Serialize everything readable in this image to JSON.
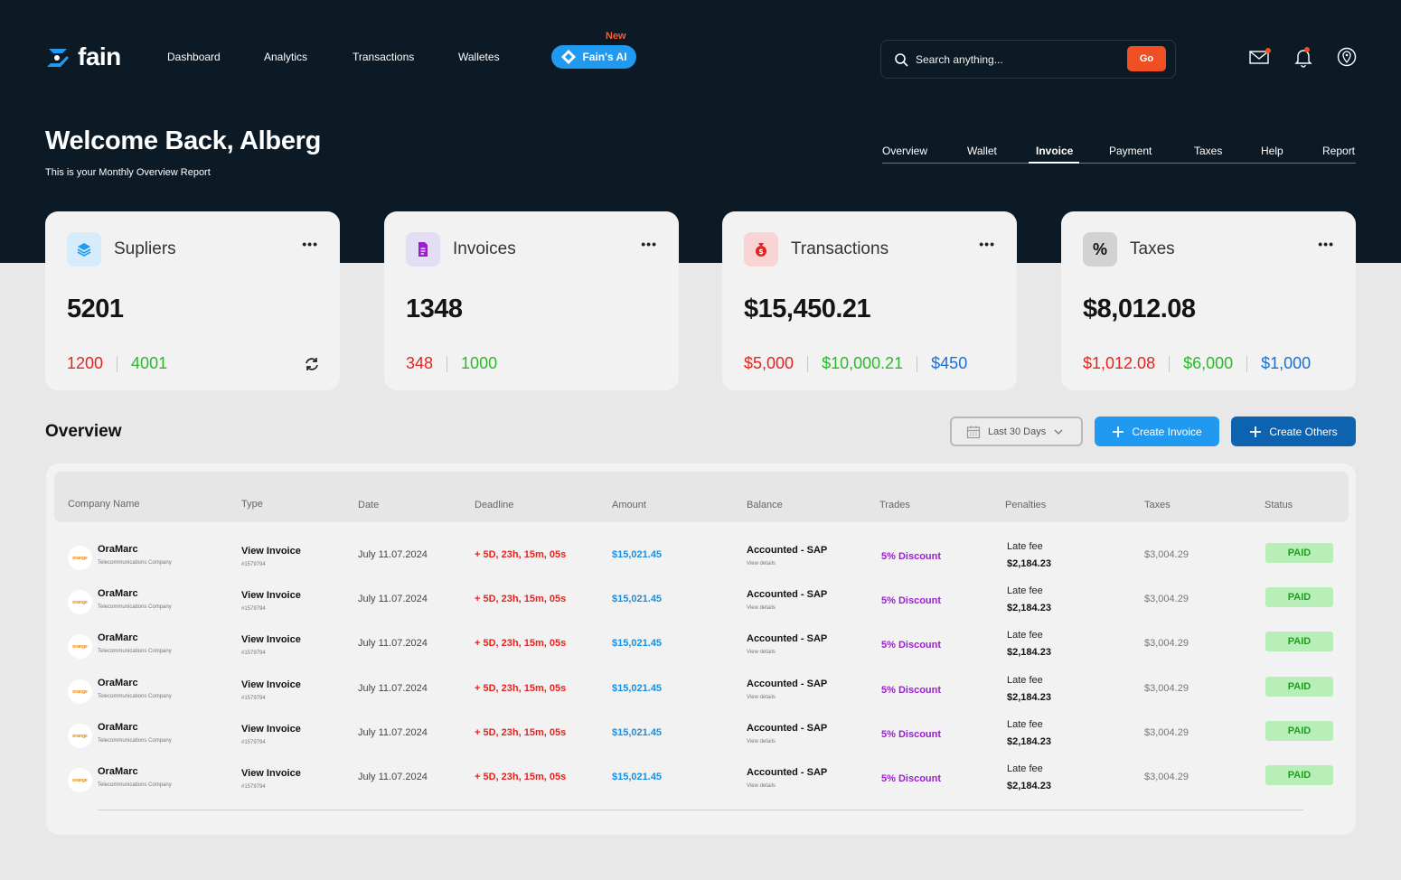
{
  "brand": {
    "name": "fain"
  },
  "nav": {
    "items": [
      "Dashboard",
      "Analytics",
      "Transactions",
      "Walletes"
    ],
    "ai_badge": "New",
    "ai_label": "Fain's AI"
  },
  "search": {
    "placeholder": "Search anything...",
    "go_label": "Go"
  },
  "top_icons": [
    "mail-icon",
    "bell-icon",
    "location-icon"
  ],
  "header": {
    "welcome": "Welcome Back, Alberg",
    "subtitle": "This is your Monthly Overview Report"
  },
  "tabs": [
    "Overview",
    "Wallet",
    "Invoice",
    "Payment",
    "Taxes",
    "Help",
    "Report"
  ],
  "active_tab": "Invoice",
  "cards": [
    {
      "title": "Supliers",
      "value": "5201",
      "subs": [
        "1200",
        "4001"
      ],
      "icon": "layers-icon"
    },
    {
      "title": "Invoices",
      "value": "1348",
      "subs": [
        "348",
        "1000"
      ],
      "icon": "document-icon"
    },
    {
      "title": "Transactions",
      "value": "$15,450.21",
      "subs": [
        "$5,000",
        "$10,000.21",
        "$450"
      ],
      "icon": "money-bag-icon"
    },
    {
      "title": "Taxes",
      "value": "$8,012.08",
      "subs": [
        "$1,012.08",
        "$6,000",
        "$1,000"
      ],
      "icon": "percent-icon",
      "icon_glyph": "%"
    }
  ],
  "overview": {
    "title": "Overview",
    "date_range": "Last 30 Days",
    "create_invoice": "Create Invoice",
    "create_others": "Create Others"
  },
  "table": {
    "columns": [
      "Company Name",
      "Type",
      "Date",
      "Deadline",
      "Amount",
      "Balance",
      "Trades",
      "Penalties",
      "Taxes",
      "Status"
    ],
    "rows": [
      {
        "logo": "orange",
        "company": "OraMarc",
        "company_sub": "Telecommunications Company",
        "type": "View Invoice",
        "type_sub": "#1579794",
        "date": "July 11.07.2024",
        "deadline": "+ 5D, 23h, 15m, 05s",
        "amount": "$15,021.45",
        "balance": "Accounted - SAP",
        "balance_sub": "View details",
        "trade": "5% Discount",
        "penalty_label": "Late fee",
        "penalty": "$2,184.23",
        "tax": "$3,004.29",
        "status": "PAID"
      },
      {
        "logo": "orange",
        "company": "OraMarc",
        "company_sub": "Telecommunications Company",
        "type": "View Invoice",
        "type_sub": "#1579794",
        "date": "July 11.07.2024",
        "deadline": "+ 5D, 23h, 15m, 05s",
        "amount": "$15,021.45",
        "balance": "Accounted - SAP",
        "balance_sub": "View details",
        "trade": "5% Discount",
        "penalty_label": "Late fee",
        "penalty": "$2,184.23",
        "tax": "$3,004.29",
        "status": "PAID"
      },
      {
        "logo": "orange",
        "company": "OraMarc",
        "company_sub": "Telecommunications Company",
        "type": "View Invoice",
        "type_sub": "#1579794",
        "date": "July 11.07.2024",
        "deadline": "+ 5D, 23h, 15m, 05s",
        "amount": "$15,021.45",
        "balance": "Accounted - SAP",
        "balance_sub": "View details",
        "trade": "5% Discount",
        "penalty_label": "Late fee",
        "penalty": "$2,184.23",
        "tax": "$3,004.29",
        "status": "PAID"
      },
      {
        "logo": "orange",
        "company": "OraMarc",
        "company_sub": "Telecommunications Company",
        "type": "View Invoice",
        "type_sub": "#1579794",
        "date": "July 11.07.2024",
        "deadline": "+ 5D, 23h, 15m, 05s",
        "amount": "$15,021.45",
        "balance": "Accounted - SAP",
        "balance_sub": "View details",
        "trade": "5% Discount",
        "penalty_label": "Late fee",
        "penalty": "$2,184.23",
        "tax": "$3,004.29",
        "status": "PAID"
      },
      {
        "logo": "orange",
        "company": "OraMarc",
        "company_sub": "Telecommunications Company",
        "type": "View Invoice",
        "type_sub": "#1579794",
        "date": "July 11.07.2024",
        "deadline": "+ 5D, 23h, 15m, 05s",
        "amount": "$15,021.45",
        "balance": "Accounted - SAP",
        "balance_sub": "View details",
        "trade": "5% Discount",
        "penalty_label": "Late fee",
        "penalty": "$2,184.23",
        "tax": "$3,004.29",
        "status": "PAID"
      },
      {
        "logo": "orange",
        "company": "OraMarc",
        "company_sub": "Telecommunications Company",
        "type": "View Invoice",
        "type_sub": "#1579794",
        "date": "July 11.07.2024",
        "deadline": "+ 5D, 23h, 15m, 05s",
        "amount": "$15,021.45",
        "balance": "Accounted - SAP",
        "balance_sub": "View details",
        "trade": "5% Discount",
        "penalty_label": "Late fee",
        "penalty": "$2,184.23",
        "tax": "$3,004.29",
        "status": "PAID"
      }
    ]
  },
  "colors": {
    "hero_bg": "#0b1a24",
    "accent_orange": "#f04e23",
    "ai_blue": "#1f9af0",
    "primary_blue": "#1a6fd4",
    "negative": "#e8221d",
    "positive": "#2bb82b",
    "paid_bg": "#b8eeb8"
  }
}
